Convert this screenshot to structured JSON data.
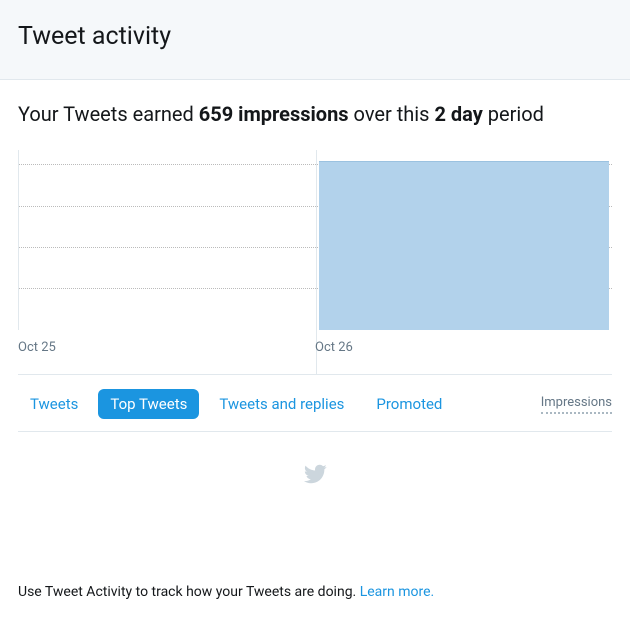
{
  "header": {
    "title": "Tweet activity"
  },
  "summary": {
    "prefix": "Your Tweets earned ",
    "impressions_phrase": "659 impressions",
    "mid": " over this ",
    "period_phrase": "2 day",
    "suffix": " period"
  },
  "chart_data": {
    "type": "bar",
    "categories": [
      "Oct 25",
      "Oct 26"
    ],
    "values": [
      0,
      659
    ],
    "title": "",
    "xlabel": "",
    "ylabel": "",
    "ylim": [
      0,
      700
    ],
    "gridlines": [
      160,
      320,
      480,
      640
    ],
    "metric": "Impressions"
  },
  "tabs": {
    "items": [
      {
        "label": "Tweets",
        "active": false
      },
      {
        "label": "Top Tweets",
        "active": true
      },
      {
        "label": "Tweets and replies",
        "active": false
      },
      {
        "label": "Promoted",
        "active": false
      }
    ],
    "metric_label": "Impressions"
  },
  "footer": {
    "text": "Use Tweet Activity to track how your Tweets are doing. ",
    "link": "Learn more."
  }
}
